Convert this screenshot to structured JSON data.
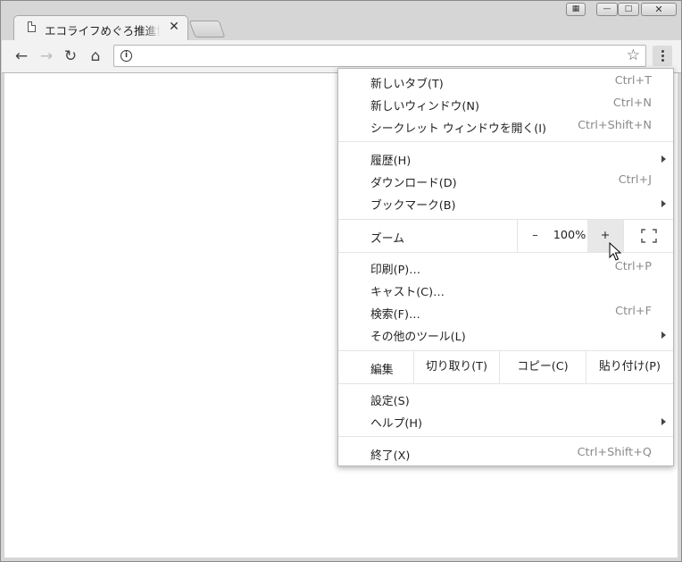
{
  "tab": {
    "title": "エコライフめぐろ推進協会"
  },
  "toolbar": {
    "address": ""
  },
  "menu": {
    "new_tab": {
      "label": "新しいタブ(T)",
      "shortcut": "Ctrl+T"
    },
    "new_window": {
      "label": "新しいウィンドウ(N)",
      "shortcut": "Ctrl+N"
    },
    "incognito": {
      "label": "シークレット ウィンドウを開く(I)",
      "shortcut": "Ctrl+Shift+N"
    },
    "history": {
      "label": "履歴(H)"
    },
    "downloads": {
      "label": "ダウンロード(D)",
      "shortcut": "Ctrl+J"
    },
    "bookmarks": {
      "label": "ブックマーク(B)"
    },
    "zoom": {
      "label": "ズーム",
      "minus": "–",
      "value": "100%",
      "plus": "+"
    },
    "print": {
      "label": "印刷(P)…",
      "shortcut": "Ctrl+P"
    },
    "cast": {
      "label": "キャスト(C)…"
    },
    "find": {
      "label": "検索(F)…",
      "shortcut": "Ctrl+F"
    },
    "more_tools": {
      "label": "その他のツール(L)"
    },
    "edit": {
      "label": "編集",
      "cut": "切り取り(T)",
      "copy": "コピー(C)",
      "paste": "貼り付け(P)"
    },
    "settings": {
      "label": "設定(S)"
    },
    "help": {
      "label": "ヘルプ(H)"
    },
    "exit": {
      "label": "終了(X)",
      "shortcut": "Ctrl+Shift+Q"
    }
  }
}
